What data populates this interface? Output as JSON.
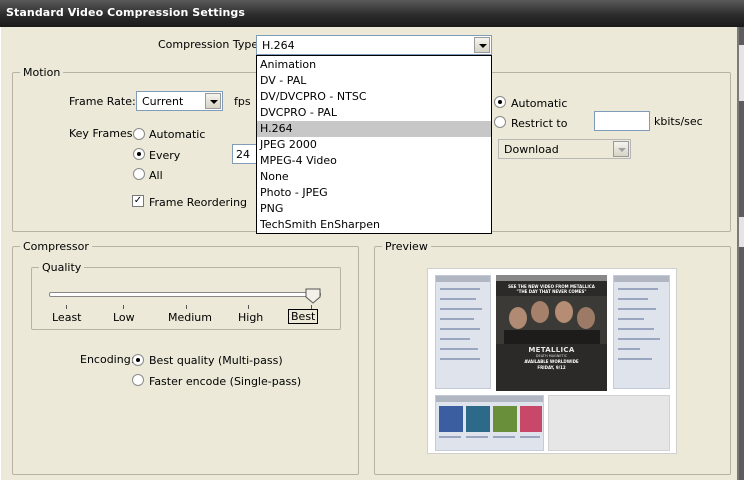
{
  "window": {
    "title": "Standard Video Compression Settings"
  },
  "compression": {
    "label": "Compression Type:",
    "selected": "H.264",
    "options": [
      "Animation",
      "DV - PAL",
      "DV/DVCPRO - NTSC",
      "DVCPRO - PAL",
      "H.264",
      "JPEG 2000",
      "MPEG-4 Video",
      "None",
      "Photo - JPEG",
      "PNG",
      "TechSmith EnSharpen"
    ]
  },
  "motion": {
    "legend": "Motion",
    "frame_rate_label": "Frame Rate:",
    "frame_rate_value": "Current",
    "fps_label": "fps",
    "key_frames_label": "Key Frames:",
    "key_automatic": "Automatic",
    "key_every": "Every",
    "key_every_value": "24",
    "key_all": "All",
    "key_selected": "Every",
    "frame_reordering": "Frame Reordering",
    "frame_reordering_checked": true
  },
  "data_rate": {
    "automatic": "Automatic",
    "restrict_to": "Restrict to",
    "restrict_value": "",
    "unit": "kbits/sec",
    "selected": "Automatic",
    "optimized_for": "Download"
  },
  "compressor": {
    "legend": "Compressor",
    "quality_legend": "Quality",
    "quality_levels": [
      "Least",
      "Low",
      "Medium",
      "High",
      "Best"
    ],
    "quality_selected": "Best",
    "encoding_label": "Encoding:",
    "encoding_best": "Best quality (Multi-pass)",
    "encoding_faster": "Faster encode (Single-pass)",
    "encoding_selected": "Best quality (Multi-pass)"
  },
  "preview": {
    "legend": "Preview",
    "banner_top": "SEE THE NEW VIDEO FROM METALLICA",
    "banner_title": "\"THE DAY THAT NEVER COMES\"",
    "band": "METALLICA",
    "album": "DEATH MAGNETIC",
    "availability": "AVAILABLE WORLDWIDE",
    "date": "FRIDAY, 9/12"
  },
  "colors": {
    "title_bar": "#2c2c2c",
    "dialog_bg": "#ece9d8",
    "list_selected": "#c7c7c7"
  }
}
